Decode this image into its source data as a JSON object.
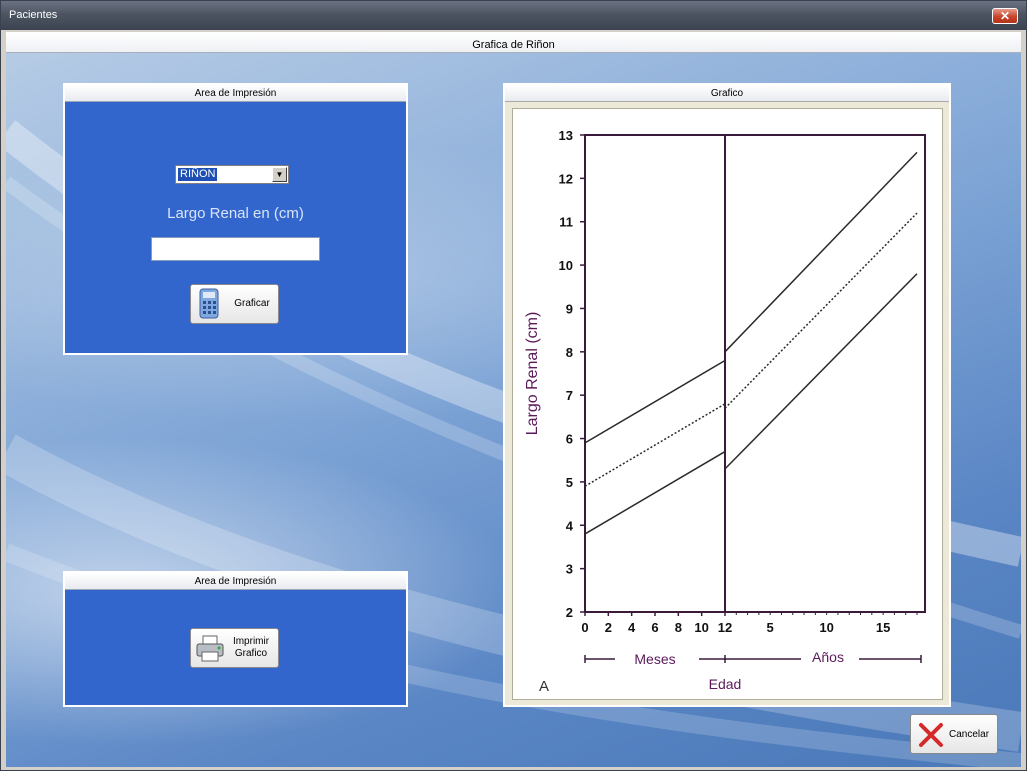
{
  "window": {
    "title": "Pacientes",
    "close_label": "✕"
  },
  "header": {
    "title": "Grafica de Riñon"
  },
  "input_panel": {
    "title": "Area de Impresión",
    "combo_value": "RIÑON",
    "label": "Largo Renal en (cm)",
    "input_value": "",
    "button_label": "Graficar"
  },
  "print_panel": {
    "title": "Area de Impresión",
    "button_label_1": "Imprimir",
    "button_label_2": "Grafico"
  },
  "graph_panel": {
    "title": "Grafico"
  },
  "cancel_button": {
    "label": "Cancelar"
  },
  "chart_data": {
    "type": "line",
    "ylabel": "Largo Renal (cm)",
    "xlabel": "Edad",
    "corner_label": "A",
    "y_ticks": [
      "2",
      "3",
      "4",
      "5",
      "6",
      "7",
      "8",
      "9",
      "10",
      "11",
      "12",
      "13"
    ],
    "ylim": [
      2,
      13
    ],
    "months": {
      "label": "Meses",
      "ticks": [
        "0",
        "2",
        "4",
        "6",
        "8",
        "10",
        "12"
      ],
      "xlim": [
        0,
        12
      ]
    },
    "years": {
      "label": "Años",
      "ticks": [
        "5",
        "10",
        "15"
      ],
      "xlim": [
        1,
        18
      ]
    },
    "series_months": [
      {
        "x": [
          0,
          12
        ],
        "y": [
          5.9,
          7.8
        ]
      },
      {
        "x": [
          0,
          12
        ],
        "y": [
          4.9,
          6.8
        ],
        "dashed": true
      },
      {
        "x": [
          0,
          12
        ],
        "y": [
          3.8,
          5.7
        ]
      }
    ],
    "series_years": [
      {
        "x": [
          1,
          18
        ],
        "y": [
          8.0,
          12.6
        ]
      },
      {
        "x": [
          1,
          18
        ],
        "y": [
          6.7,
          11.2
        ],
        "dashed": true
      },
      {
        "x": [
          1,
          18
        ],
        "y": [
          5.3,
          9.8
        ]
      }
    ],
    "colors": {
      "frame": "#3a1a3a",
      "text": "#5a1a5a",
      "line": "#2a2a2a"
    }
  }
}
